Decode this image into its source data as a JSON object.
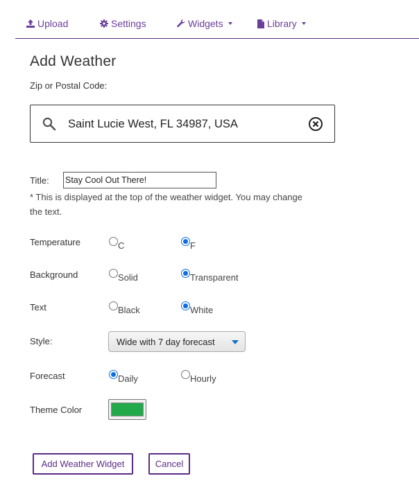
{
  "nav": {
    "upload": "Upload",
    "settings": "Settings",
    "widgets": "Widgets",
    "library": "Library"
  },
  "page": {
    "title": "Add Weather",
    "zip_label": "Zip or Postal Code:"
  },
  "search": {
    "value": "Saint Lucie West, FL 34987, USA"
  },
  "title_field": {
    "label": "Title:",
    "value": "Stay Cool Out There!",
    "help": "* This is displayed at the top of the weather widget. You may change the text."
  },
  "temperature": {
    "label": "Temperature",
    "options": [
      "C",
      "F"
    ],
    "selected": "F"
  },
  "background": {
    "label": "Background",
    "options": [
      "Solid",
      "Transparent"
    ],
    "selected": "Transparent"
  },
  "text": {
    "label": "Text",
    "options": [
      "Black",
      "White"
    ],
    "selected": "White"
  },
  "style": {
    "label": "Style:",
    "selected": "Wide with 7 day forecast"
  },
  "forecast": {
    "label": "Forecast",
    "options": [
      "Daily",
      "Hourly"
    ],
    "selected": "Daily"
  },
  "theme": {
    "label": "Theme Color",
    "color": "#22aa4a"
  },
  "buttons": {
    "add": "Add Weather Widget",
    "cancel": "Cancel"
  },
  "colors": {
    "accent": "#5b2a86",
    "radio_checked": "#0b6fe0"
  }
}
